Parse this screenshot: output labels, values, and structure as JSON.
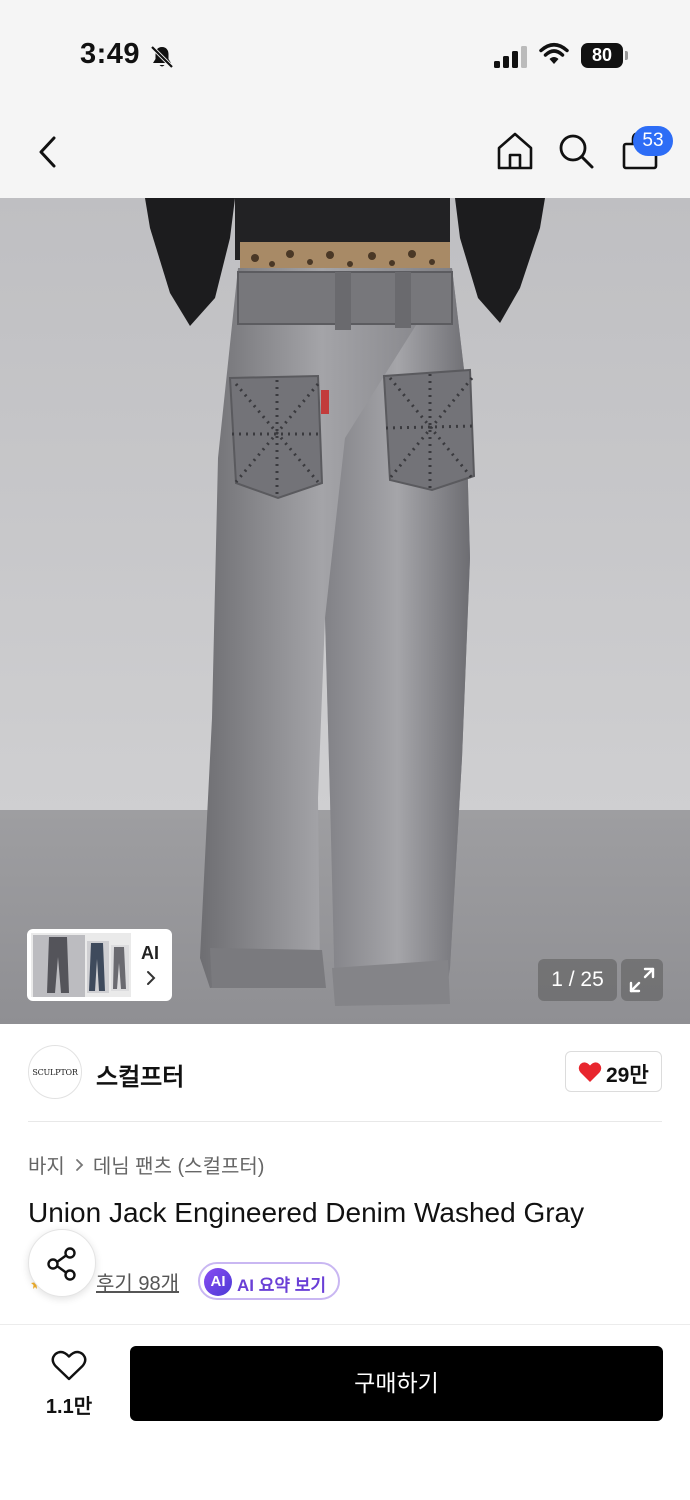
{
  "status_bar": {
    "time": "3:49",
    "battery": "80",
    "icons": [
      "bell-slash-icon",
      "cellular-signal-icon",
      "wifi-icon",
      "battery-icon"
    ]
  },
  "header": {
    "icons": [
      "back-chevron-icon",
      "home-icon",
      "search-icon",
      "shopping-bag-icon"
    ],
    "cart_badge": "53",
    "badge_color": "#2d6df6"
  },
  "gallery": {
    "ai_label": "AI",
    "counter": "1 / 25",
    "image_subject": "gray washed wide-leg denim jeans, back view"
  },
  "brand": {
    "logo_text": "SCULPTOR",
    "name": "스컬프터",
    "like_count": "29만",
    "like_color": "#e8262e"
  },
  "breadcrumb": {
    "level1": "바지",
    "level2": "데님 팬츠 (스컬프터)"
  },
  "product": {
    "title": "Union Jack Engineered Denim Washed Gray"
  },
  "reviews": {
    "label": "후기 98개",
    "ai_badge": "AI",
    "ai_summary_label": "AI 요약 보기"
  },
  "bottom_bar": {
    "wish_count": "1.1만",
    "buy_label": "구매하기"
  }
}
